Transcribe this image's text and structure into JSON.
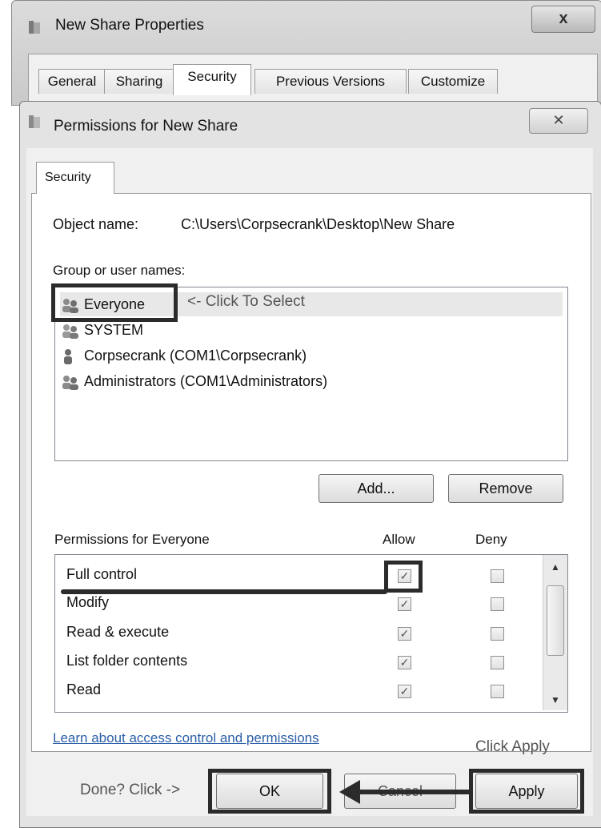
{
  "outer_window": {
    "title": "New Share Properties",
    "close_glyph": "x",
    "tabs": [
      {
        "label": "General"
      },
      {
        "label": "Sharing"
      },
      {
        "label": "Security"
      },
      {
        "label": "Previous Versions"
      },
      {
        "label": "Customize"
      }
    ],
    "active_tab": "Security"
  },
  "dialog": {
    "title": "Permissions for New Share",
    "close_glyph": "✕",
    "tab": "Security",
    "object_label": "Object name:",
    "object_value": "C:\\Users\\Corpsecrank\\Desktop\\New Share",
    "group_label": "Group or user names:",
    "users": [
      {
        "name": "Everyone",
        "icon": "group-icon",
        "selected": true
      },
      {
        "name": "SYSTEM",
        "icon": "group-icon",
        "selected": false
      },
      {
        "name": "Corpsecrank (COM1\\Corpsecrank)",
        "icon": "user-icon",
        "selected": false
      },
      {
        "name": "Administrators (COM1\\Administrators)",
        "icon": "group-icon",
        "selected": false
      }
    ],
    "add_button": "Add...",
    "remove_button": "Remove",
    "permissions_label": "Permissions for Everyone",
    "allow_header": "Allow",
    "deny_header": "Deny",
    "permissions": [
      {
        "name": "Full control",
        "allow": true,
        "deny": false
      },
      {
        "name": "Modify",
        "allow": true,
        "deny": false
      },
      {
        "name": "Read & execute",
        "allow": true,
        "deny": false
      },
      {
        "name": "List folder contents",
        "allow": true,
        "deny": false
      },
      {
        "name": "Read",
        "allow": true,
        "deny": false
      }
    ],
    "learn_link": "Learn about access control and permissions",
    "ok_button": "OK",
    "cancel_button": "Cancel",
    "apply_button": "Apply"
  },
  "annotations": {
    "click_to_select": "<- Click To Select",
    "click_apply": "Click Apply",
    "done_click": "Done? Click ->"
  },
  "colors": {
    "annotation_dark": "#2b2b2b",
    "link": "#2b5ea8"
  }
}
